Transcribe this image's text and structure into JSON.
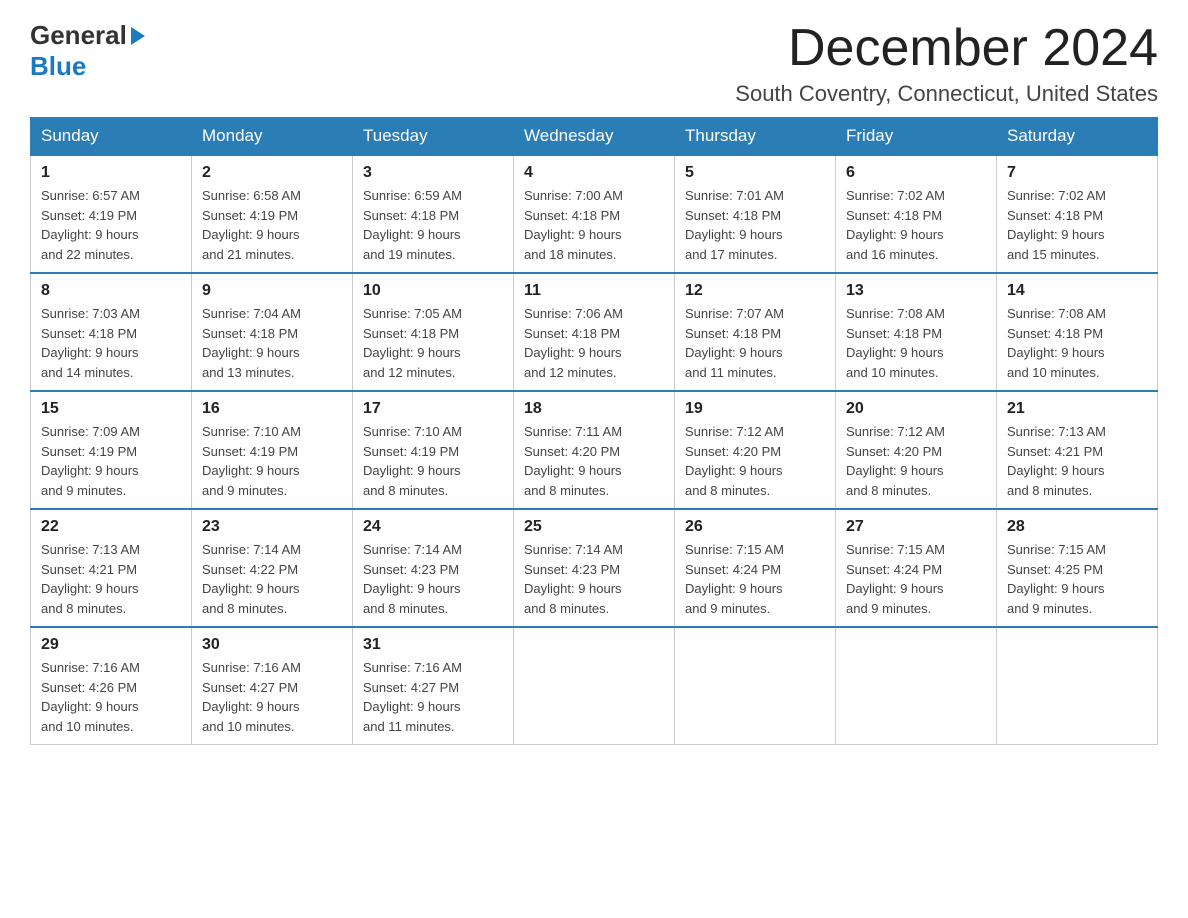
{
  "header": {
    "logo_general": "General",
    "logo_blue": "Blue",
    "month_title": "December 2024",
    "location": "South Coventry, Connecticut, United States"
  },
  "weekdays": [
    "Sunday",
    "Monday",
    "Tuesday",
    "Wednesday",
    "Thursday",
    "Friday",
    "Saturday"
  ],
  "weeks": [
    [
      {
        "day": "1",
        "sunrise": "6:57 AM",
        "sunset": "4:19 PM",
        "daylight": "9 hours and 22 minutes."
      },
      {
        "day": "2",
        "sunrise": "6:58 AM",
        "sunset": "4:19 PM",
        "daylight": "9 hours and 21 minutes."
      },
      {
        "day": "3",
        "sunrise": "6:59 AM",
        "sunset": "4:18 PM",
        "daylight": "9 hours and 19 minutes."
      },
      {
        "day": "4",
        "sunrise": "7:00 AM",
        "sunset": "4:18 PM",
        "daylight": "9 hours and 18 minutes."
      },
      {
        "day": "5",
        "sunrise": "7:01 AM",
        "sunset": "4:18 PM",
        "daylight": "9 hours and 17 minutes."
      },
      {
        "day": "6",
        "sunrise": "7:02 AM",
        "sunset": "4:18 PM",
        "daylight": "9 hours and 16 minutes."
      },
      {
        "day": "7",
        "sunrise": "7:02 AM",
        "sunset": "4:18 PM",
        "daylight": "9 hours and 15 minutes."
      }
    ],
    [
      {
        "day": "8",
        "sunrise": "7:03 AM",
        "sunset": "4:18 PM",
        "daylight": "9 hours and 14 minutes."
      },
      {
        "day": "9",
        "sunrise": "7:04 AM",
        "sunset": "4:18 PM",
        "daylight": "9 hours and 13 minutes."
      },
      {
        "day": "10",
        "sunrise": "7:05 AM",
        "sunset": "4:18 PM",
        "daylight": "9 hours and 12 minutes."
      },
      {
        "day": "11",
        "sunrise": "7:06 AM",
        "sunset": "4:18 PM",
        "daylight": "9 hours and 12 minutes."
      },
      {
        "day": "12",
        "sunrise": "7:07 AM",
        "sunset": "4:18 PM",
        "daylight": "9 hours and 11 minutes."
      },
      {
        "day": "13",
        "sunrise": "7:08 AM",
        "sunset": "4:18 PM",
        "daylight": "9 hours and 10 minutes."
      },
      {
        "day": "14",
        "sunrise": "7:08 AM",
        "sunset": "4:18 PM",
        "daylight": "9 hours and 10 minutes."
      }
    ],
    [
      {
        "day": "15",
        "sunrise": "7:09 AM",
        "sunset": "4:19 PM",
        "daylight": "9 hours and 9 minutes."
      },
      {
        "day": "16",
        "sunrise": "7:10 AM",
        "sunset": "4:19 PM",
        "daylight": "9 hours and 9 minutes."
      },
      {
        "day": "17",
        "sunrise": "7:10 AM",
        "sunset": "4:19 PM",
        "daylight": "9 hours and 8 minutes."
      },
      {
        "day": "18",
        "sunrise": "7:11 AM",
        "sunset": "4:20 PM",
        "daylight": "9 hours and 8 minutes."
      },
      {
        "day": "19",
        "sunrise": "7:12 AM",
        "sunset": "4:20 PM",
        "daylight": "9 hours and 8 minutes."
      },
      {
        "day": "20",
        "sunrise": "7:12 AM",
        "sunset": "4:20 PM",
        "daylight": "9 hours and 8 minutes."
      },
      {
        "day": "21",
        "sunrise": "7:13 AM",
        "sunset": "4:21 PM",
        "daylight": "9 hours and 8 minutes."
      }
    ],
    [
      {
        "day": "22",
        "sunrise": "7:13 AM",
        "sunset": "4:21 PM",
        "daylight": "9 hours and 8 minutes."
      },
      {
        "day": "23",
        "sunrise": "7:14 AM",
        "sunset": "4:22 PM",
        "daylight": "9 hours and 8 minutes."
      },
      {
        "day": "24",
        "sunrise": "7:14 AM",
        "sunset": "4:23 PM",
        "daylight": "9 hours and 8 minutes."
      },
      {
        "day": "25",
        "sunrise": "7:14 AM",
        "sunset": "4:23 PM",
        "daylight": "9 hours and 8 minutes."
      },
      {
        "day": "26",
        "sunrise": "7:15 AM",
        "sunset": "4:24 PM",
        "daylight": "9 hours and 9 minutes."
      },
      {
        "day": "27",
        "sunrise": "7:15 AM",
        "sunset": "4:24 PM",
        "daylight": "9 hours and 9 minutes."
      },
      {
        "day": "28",
        "sunrise": "7:15 AM",
        "sunset": "4:25 PM",
        "daylight": "9 hours and 9 minutes."
      }
    ],
    [
      {
        "day": "29",
        "sunrise": "7:16 AM",
        "sunset": "4:26 PM",
        "daylight": "9 hours and 10 minutes."
      },
      {
        "day": "30",
        "sunrise": "7:16 AM",
        "sunset": "4:27 PM",
        "daylight": "9 hours and 10 minutes."
      },
      {
        "day": "31",
        "sunrise": "7:16 AM",
        "sunset": "4:27 PM",
        "daylight": "9 hours and 11 minutes."
      },
      null,
      null,
      null,
      null
    ]
  ],
  "labels": {
    "sunrise": "Sunrise:",
    "sunset": "Sunset:",
    "daylight": "Daylight:"
  }
}
